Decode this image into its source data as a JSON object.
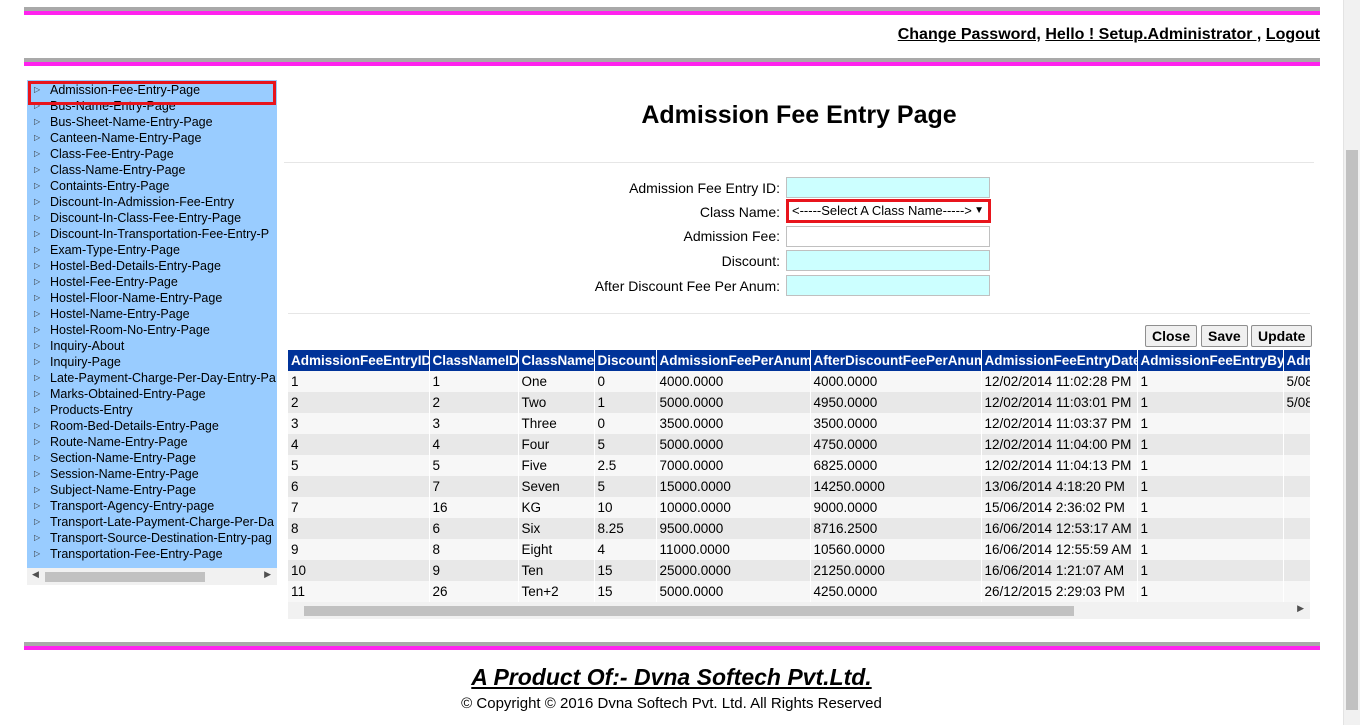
{
  "header": {
    "change_password": "Change Password,",
    "greeting": "Hello ! Setup.Administrator ,",
    "logout": "Logout"
  },
  "sidebar": {
    "items": [
      "Admission-Fee-Entry-Page",
      "Bus-Name-Entry-Page",
      "Bus-Sheet-Name-Entry-Page",
      "Canteen-Name-Entry-Page",
      "Class-Fee-Entry-Page",
      "Class-Name-Entry-Page",
      "Containts-Entry-Page",
      "Discount-In-Admission-Fee-Entry",
      "Discount-In-Class-Fee-Entry-Page",
      "Discount-In-Transportation-Fee-Entry-P",
      "Exam-Type-Entry-Page",
      "Hostel-Bed-Details-Entry-Page",
      "Hostel-Fee-Entry-Page",
      "Hostel-Floor-Name-Entry-Page",
      "Hostel-Name-Entry-Page",
      "Hostel-Room-No-Entry-Page",
      "Inquiry-About",
      "Inquiry-Page",
      "Late-Payment-Charge-Per-Day-Entry-Pa",
      "Marks-Obtained-Entry-Page",
      "Products-Entry",
      "Room-Bed-Details-Entry-Page",
      "Route-Name-Entry-Page",
      "Section-Name-Entry-Page",
      "Session-Name-Entry-Page",
      "Subject-Name-Entry-Page",
      "Transport-Agency-Entry-page",
      "Transport-Late-Payment-Charge-Per-Da",
      "Transport-Source-Destination-Entry-pag",
      "Transportation-Fee-Entry-Page"
    ]
  },
  "page_title": "Admission Fee Entry Page",
  "form": {
    "entry_id_label": "Admission Fee Entry ID:",
    "class_name_label": "Class Name:",
    "class_name_value": "<-----Select A Class Name----->",
    "admission_fee_label": "Admission Fee:",
    "discount_label": "Discount:",
    "after_discount_label": "After Discount Fee Per Anum:"
  },
  "buttons": {
    "close": "Close",
    "save": "Save",
    "update": "Update"
  },
  "grid": {
    "columns": [
      "AdmissionFeeEntryID",
      "ClassNameID",
      "ClassName",
      "Discount",
      "AdmissionFeePerAnum",
      "AfterDiscountFeePerAnum",
      "AdmissionFeeEntryDate",
      "AdmissionFeeEntryBy",
      "Adm"
    ],
    "rows": [
      [
        "1",
        "1",
        "One",
        "0",
        "4000.0000",
        "4000.0000",
        "12/02/2014 11:02:28 PM",
        "1",
        "5/08"
      ],
      [
        "2",
        "2",
        "Two",
        "1",
        "5000.0000",
        "4950.0000",
        "12/02/2014 11:03:01 PM",
        "1",
        "5/08"
      ],
      [
        "3",
        "3",
        "Three",
        "0",
        "3500.0000",
        "3500.0000",
        "12/02/2014 11:03:37 PM",
        "1",
        ""
      ],
      [
        "4",
        "4",
        "Four",
        "5",
        "5000.0000",
        "4750.0000",
        "12/02/2014 11:04:00 PM",
        "1",
        ""
      ],
      [
        "5",
        "5",
        "Five",
        "2.5",
        "7000.0000",
        "6825.0000",
        "12/02/2014 11:04:13 PM",
        "1",
        ""
      ],
      [
        "6",
        "7",
        "Seven",
        "5",
        "15000.0000",
        "14250.0000",
        "13/06/2014 4:18:20 PM",
        "1",
        ""
      ],
      [
        "7",
        "16",
        "KG",
        "10",
        "10000.0000",
        "9000.0000",
        "15/06/2014 2:36:02 PM",
        "1",
        ""
      ],
      [
        "8",
        "6",
        "Six",
        "8.25",
        "9500.0000",
        "8716.2500",
        "16/06/2014 12:53:17 AM",
        "1",
        ""
      ],
      [
        "9",
        "8",
        "Eight",
        "4",
        "11000.0000",
        "10560.0000",
        "16/06/2014 12:55:59 AM",
        "1",
        ""
      ],
      [
        "10",
        "9",
        "Ten",
        "15",
        "25000.0000",
        "21250.0000",
        "16/06/2014 1:21:07 AM",
        "1",
        ""
      ],
      [
        "11",
        "26",
        "Ten+2",
        "15",
        "5000.0000",
        "4250.0000",
        "26/12/2015 2:29:03 PM",
        "1",
        ""
      ]
    ]
  },
  "footer": {
    "product": "A Product Of:- Dvna Softech Pvt.Ltd.",
    "copyright": "© Copyright © 2016 Dvna Softech Pvt. Ltd. All Rights Reserved"
  },
  "colors": {
    "accent_band": "#ff22ee",
    "sidebar_bg": "#99ccff",
    "grid_header_bg": "#003399",
    "input_bg": "#ccffff",
    "highlight_border": "#e8141c"
  }
}
